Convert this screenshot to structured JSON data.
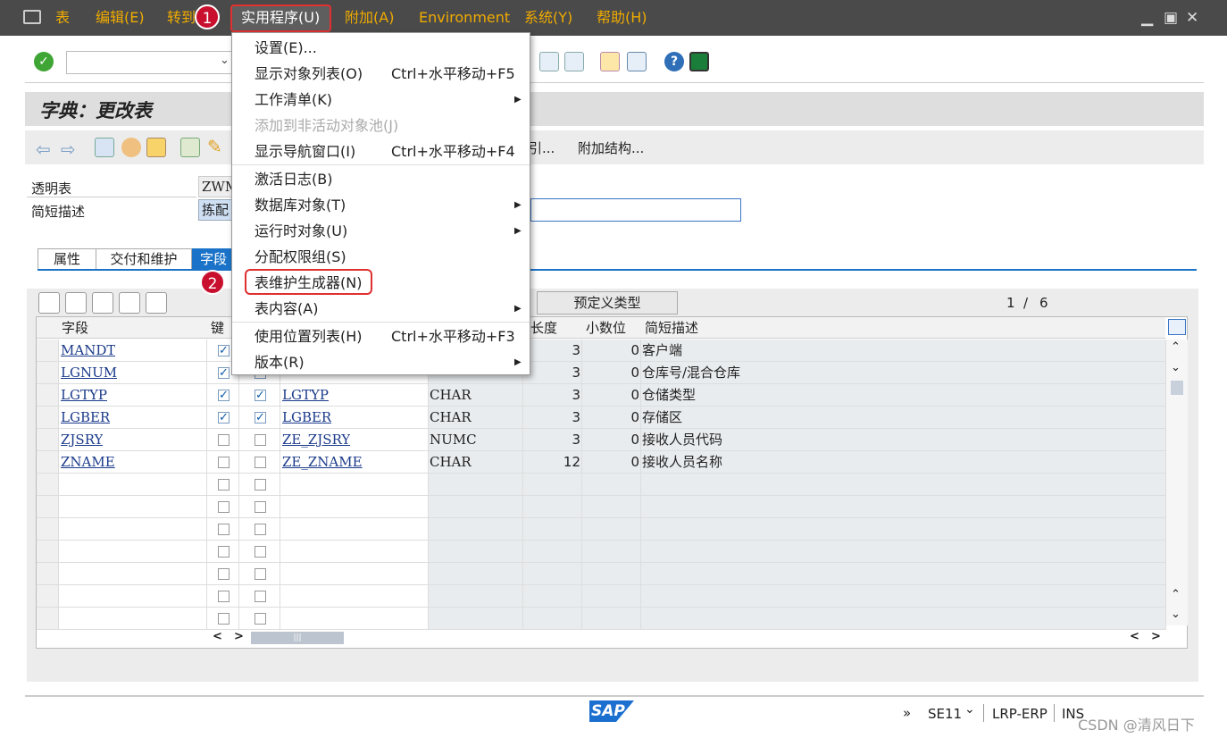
{
  "menubar": {
    "items": [
      "表",
      "编辑(E)",
      "转到",
      "实用程序(U)",
      "附加(A)",
      "Environment",
      "系统(Y)",
      "帮助(H)"
    ]
  },
  "page_title": "字典：更改表",
  "app_toolbar": {
    "more1": "引...",
    "more2": "附加结构..."
  },
  "fields": {
    "transparent_label": "透明表",
    "transparent_value": "ZWM",
    "desc_label": "简短描述",
    "desc_value": "拣配"
  },
  "tabs": [
    "属性",
    "交付和维护",
    "字段"
  ],
  "predefined_btn": "预定义类型",
  "pager": {
    "current": "1",
    "sep": "/",
    "total": "6"
  },
  "table": {
    "headers": [
      "字段",
      "键",
      "",
      "",
      "",
      "长度",
      "小数位",
      "简短描述"
    ],
    "rows": [
      {
        "field": "MANDT",
        "key": true,
        "init": true,
        "elem": "",
        "type": "",
        "len": "3",
        "dec": "0",
        "desc": "客户端"
      },
      {
        "field": "LGNUM",
        "key": true,
        "init": true,
        "elem": "",
        "type": "",
        "len": "3",
        "dec": "0",
        "desc": "仓库号/混合仓库"
      },
      {
        "field": "LGTYP",
        "key": true,
        "init": true,
        "elem": "LGTYP",
        "type": "CHAR",
        "len": "3",
        "dec": "0",
        "desc": "仓储类型"
      },
      {
        "field": "LGBER",
        "key": true,
        "init": true,
        "elem": "LGBER",
        "type": "CHAR",
        "len": "3",
        "dec": "0",
        "desc": "存储区"
      },
      {
        "field": "ZJSRY",
        "key": false,
        "init": false,
        "elem": "ZE_ZJSRY",
        "type": "NUMC",
        "len": "3",
        "dec": "0",
        "desc": "接收人员代码"
      },
      {
        "field": "ZNAME",
        "key": false,
        "init": false,
        "elem": "ZE_ZNAME",
        "type": "CHAR",
        "len": "12",
        "dec": "0",
        "desc": "接收人员名称"
      }
    ],
    "empty_rows": 7
  },
  "dropdown": {
    "items": [
      {
        "label": "设置(E)...",
        "shortcut": "",
        "arrow": false,
        "disabled": false
      },
      {
        "label": "显示对象列表(O)",
        "shortcut": "Ctrl+水平移动+F5",
        "arrow": false,
        "disabled": false
      },
      {
        "label": "工作清单(K)",
        "shortcut": "",
        "arrow": true,
        "disabled": false
      },
      {
        "label": "添加到非活动对象池(J)",
        "shortcut": "",
        "arrow": false,
        "disabled": true
      },
      {
        "label": "显示导航窗口(I)",
        "shortcut": "Ctrl+水平移动+F4",
        "arrow": false,
        "disabled": false
      },
      {
        "label": "激活日志(B)",
        "shortcut": "",
        "arrow": false,
        "disabled": false
      },
      {
        "label": "数据库对象(T)",
        "shortcut": "",
        "arrow": true,
        "disabled": false
      },
      {
        "label": "运行时对象(U)",
        "shortcut": "",
        "arrow": true,
        "disabled": false
      },
      {
        "label": "分配权限组(S)",
        "shortcut": "",
        "arrow": false,
        "disabled": false
      },
      {
        "label": "表维护生成器(N)",
        "shortcut": "",
        "arrow": false,
        "disabled": false
      },
      {
        "label": "表内容(A)",
        "shortcut": "",
        "arrow": true,
        "disabled": false
      },
      {
        "label": "使用位置列表(H)",
        "shortcut": "Ctrl+水平移动+F3",
        "arrow": false,
        "disabled": false
      },
      {
        "label": "版本(R)",
        "shortcut": "",
        "arrow": true,
        "disabled": false
      }
    ]
  },
  "badges": [
    "1",
    "2"
  ],
  "status": {
    "arrows": "»",
    "tcode": "SE11",
    "system": "LRP-ERP",
    "mode": "INS",
    "watermark": "CSDN @清风日下",
    "logo": "SAP"
  },
  "colors": {
    "menubar": "#4a4a4a",
    "accent": "#f0ab00",
    "badge": "#c8102e",
    "tab_active": "#1a73c8"
  }
}
